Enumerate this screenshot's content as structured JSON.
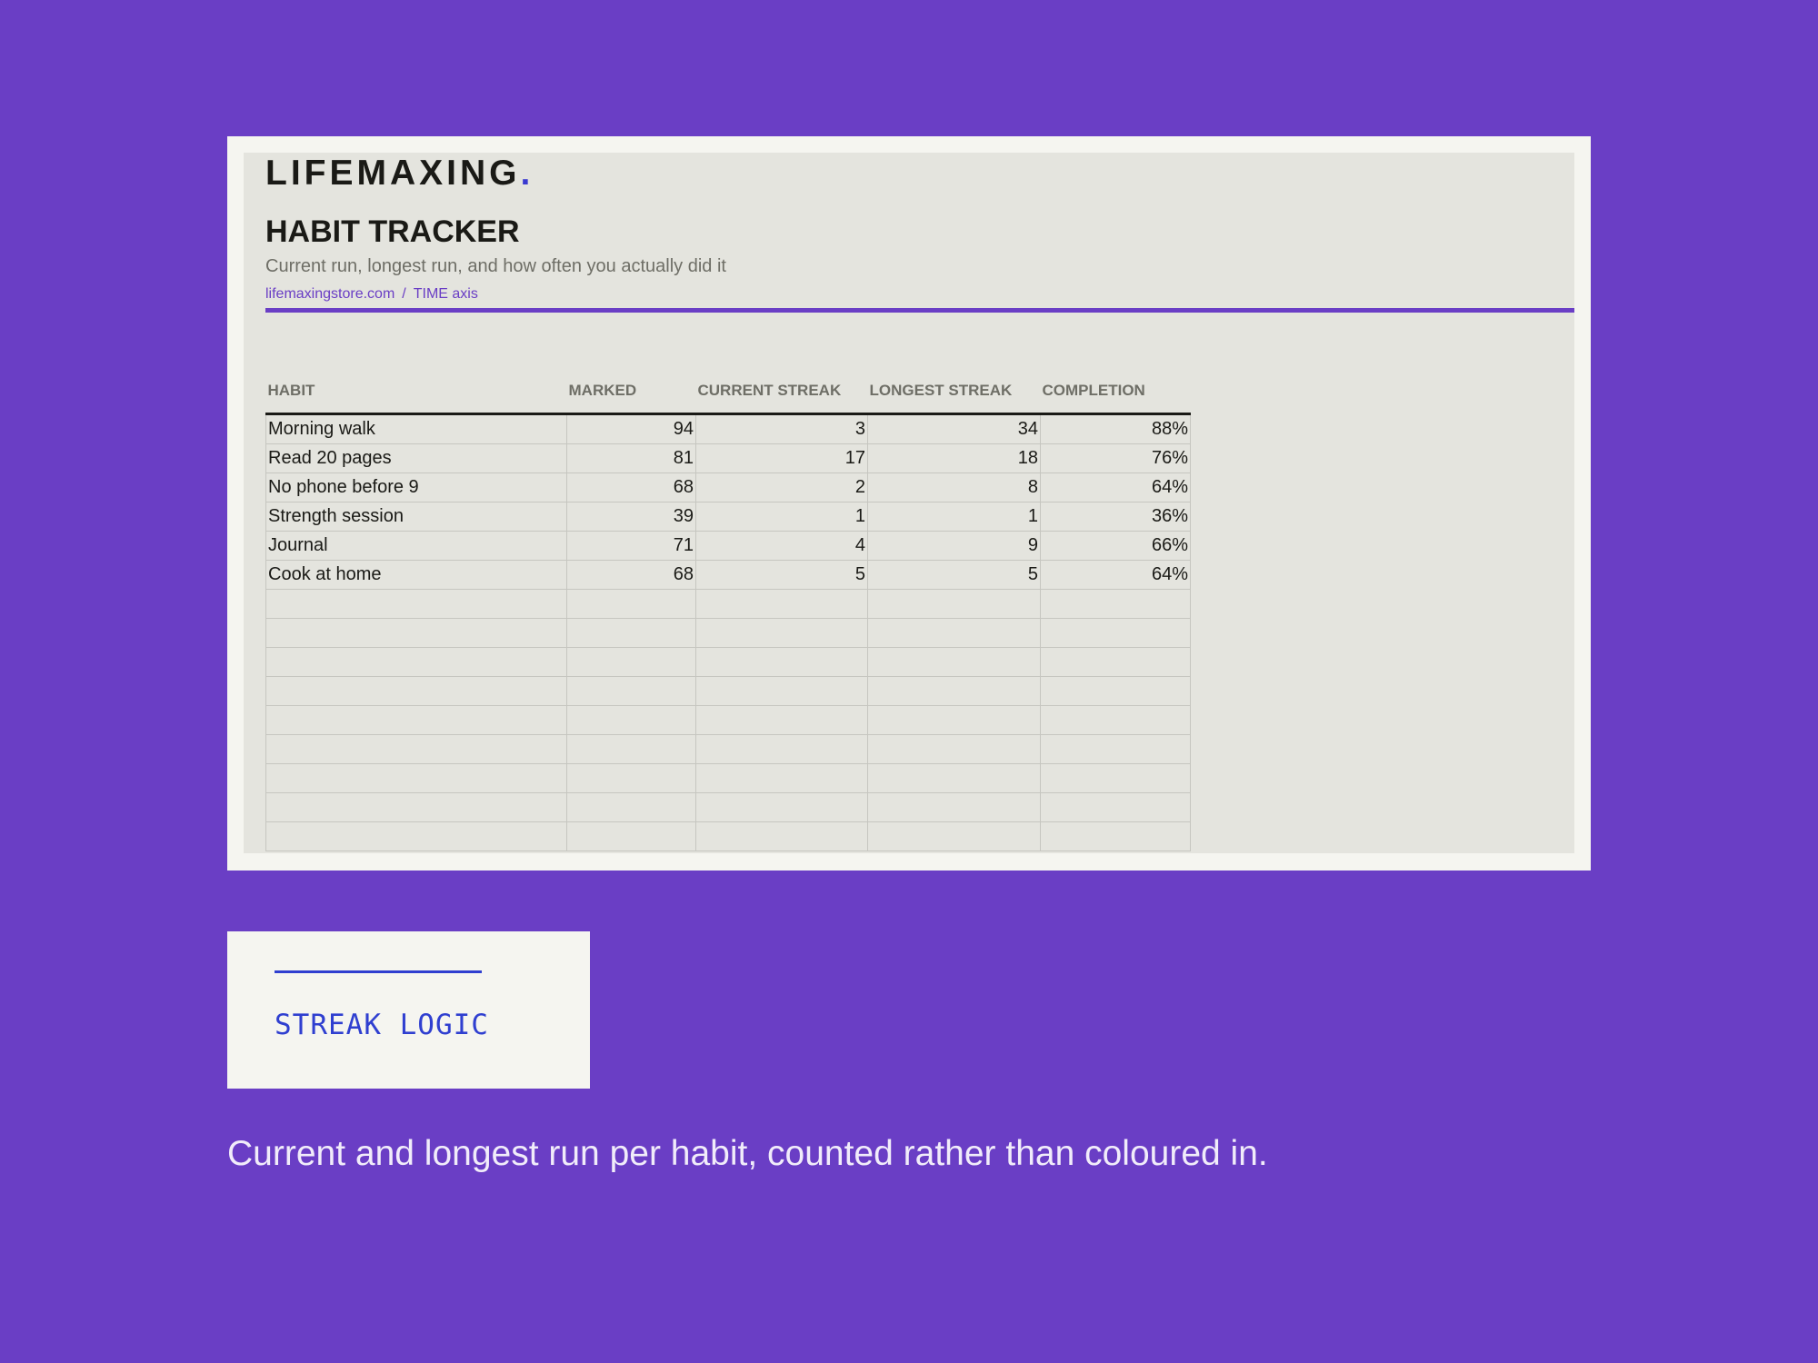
{
  "brand": {
    "name": "LIFEMAXING",
    "dot": "."
  },
  "header": {
    "title": "HABIT TRACKER",
    "subtitle": "Current run, longest run, and how often you actually did it",
    "breadcrumb": [
      "lifemaxingstore.com",
      "TIME axis"
    ],
    "breadcrumb_separator": "/"
  },
  "table": {
    "columns": [
      "HABIT",
      "MARKED",
      "CURRENT STREAK",
      "LONGEST STREAK",
      "COMPLETION"
    ],
    "rows": [
      [
        "Morning walk",
        "94",
        "3",
        "34",
        "88%"
      ],
      [
        "Read 20 pages",
        "81",
        "17",
        "18",
        "76%"
      ],
      [
        "No phone before 9",
        "68",
        "2",
        "8",
        "64%"
      ],
      [
        "Strength session",
        "39",
        "1",
        "1",
        "36%"
      ],
      [
        "Journal",
        "71",
        "4",
        "9",
        "66%"
      ],
      [
        "Cook at home",
        "68",
        "5",
        "5",
        "64%"
      ],
      [
        "",
        "",
        "",
        "",
        ""
      ],
      [
        "",
        "",
        "",
        "",
        ""
      ],
      [
        "",
        "",
        "",
        "",
        ""
      ],
      [
        "",
        "",
        "",
        "",
        ""
      ],
      [
        "",
        "",
        "",
        "",
        ""
      ],
      [
        "",
        "",
        "",
        "",
        ""
      ],
      [
        "",
        "",
        "",
        "",
        ""
      ],
      [
        "",
        "",
        "",
        "",
        ""
      ],
      [
        "",
        "",
        "",
        "",
        ""
      ]
    ]
  },
  "logic_card": {
    "label": "STREAK LOGIC"
  },
  "caption": "Current and longest run per habit, counted rather than coloured in.",
  "colors": {
    "background": "#6a3ec5",
    "accent": "#6a3ec5",
    "logic_blue": "#2f3fd0",
    "card": "#f5f5f0",
    "sheet": "#e4e4de"
  }
}
